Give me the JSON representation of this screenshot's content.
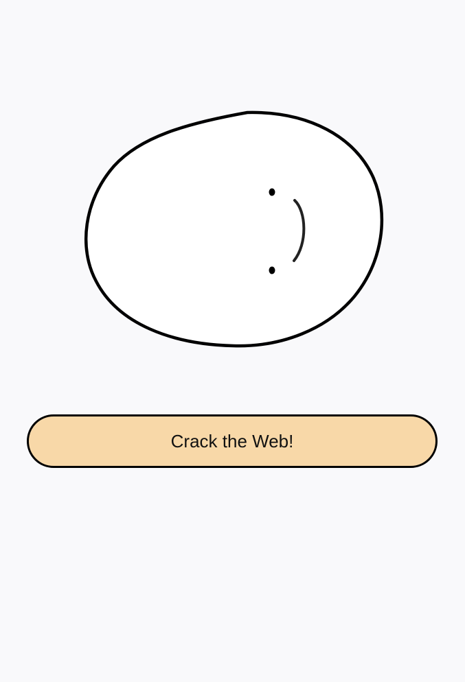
{
  "button": {
    "label": "Crack the Web!"
  },
  "colors": {
    "background": "#f9f9fb",
    "egg_fill": "#ffffff",
    "outline": "#000000",
    "button_fill": "#f8d8a8"
  },
  "icons": {
    "egg": "egg-face-icon"
  }
}
